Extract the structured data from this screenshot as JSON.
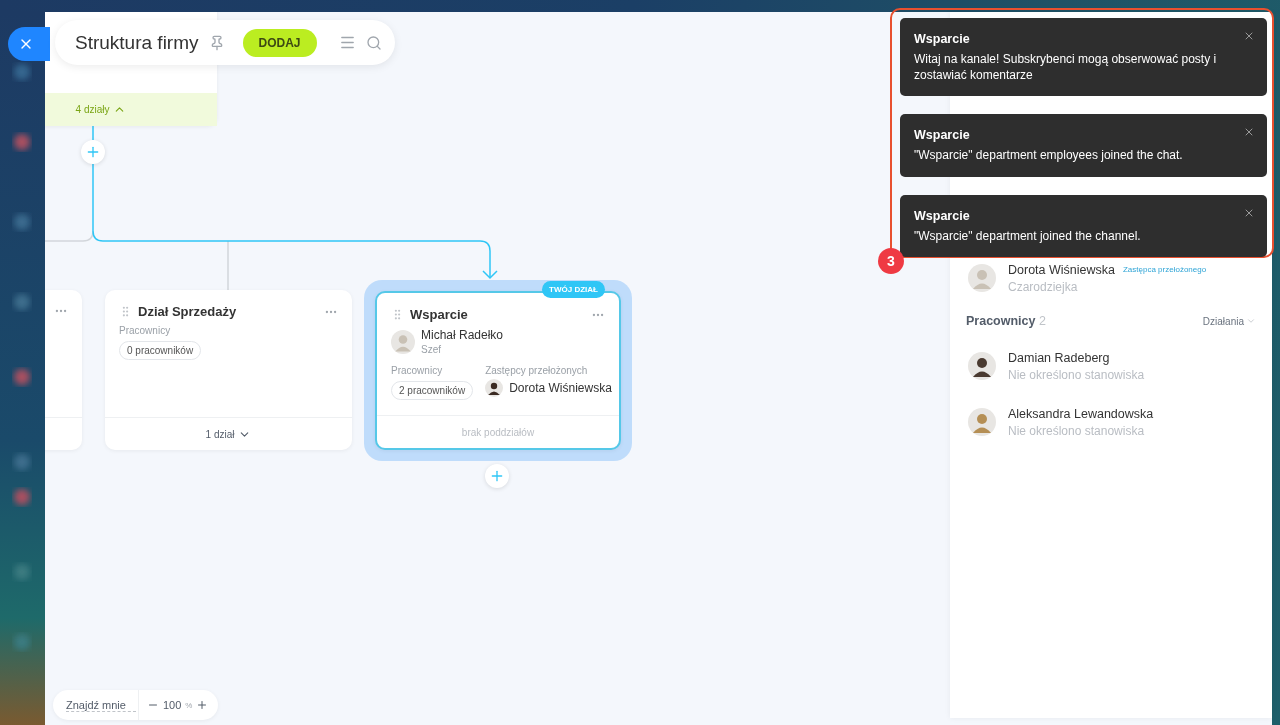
{
  "toolbar": {
    "title": "Struktura firmy",
    "add_button": "DODAJ"
  },
  "canvas": {
    "top_card": {
      "footer": "4 działy",
      "expanded": true
    },
    "departments": [
      {
        "kind": "cut"
      },
      {
        "kind": "standard",
        "name": "Dział Sprzedaży",
        "employees_label": "Pracownicy",
        "employees": "0 pracowników",
        "footer": "1 dział",
        "expanded": false
      },
      {
        "kind": "current",
        "badge": "TWÓJ DZIAŁ",
        "name": "Wsparcie",
        "head": {
          "name": "Michał Radełko",
          "role": "Szef"
        },
        "employees_label": "Pracownicy",
        "employees": "2 pracowników",
        "deputies_label": "Zastępcy przełożonych",
        "deputy": "Dorota Wiśniewska",
        "footer": "brak poddziałów"
      }
    ]
  },
  "zoom": {
    "find_me": "Znajdź mnie",
    "value": "100",
    "unit": "%"
  },
  "panel": {
    "sections": [
      {
        "people": [
          {
            "name": "Dorota Wiśniewska",
            "role": "Czarodziejka",
            "badge": "Zastępca przełożonego"
          }
        ]
      },
      {
        "title": "Pracownicy",
        "count": "2",
        "action": "Działania",
        "people": [
          {
            "name": "Damian Radeberg",
            "role": "Nie określono stanowiska"
          },
          {
            "name": "Aleksandra Lewandowska",
            "role": "Nie określono stanowiska"
          }
        ]
      }
    ]
  },
  "notifications": [
    {
      "title": "Wsparcie",
      "text": "Witaj na kanale! Subskrybenci mogą obserwować posty i zostawiać komentarze"
    },
    {
      "title": "Wsparcie",
      "text": "\"Wsparcie\" department employees joined the chat."
    },
    {
      "title": "Wsparcie",
      "text": "\"Wsparcie\" department joined the channel."
    }
  ],
  "annotation": {
    "number": "3"
  }
}
